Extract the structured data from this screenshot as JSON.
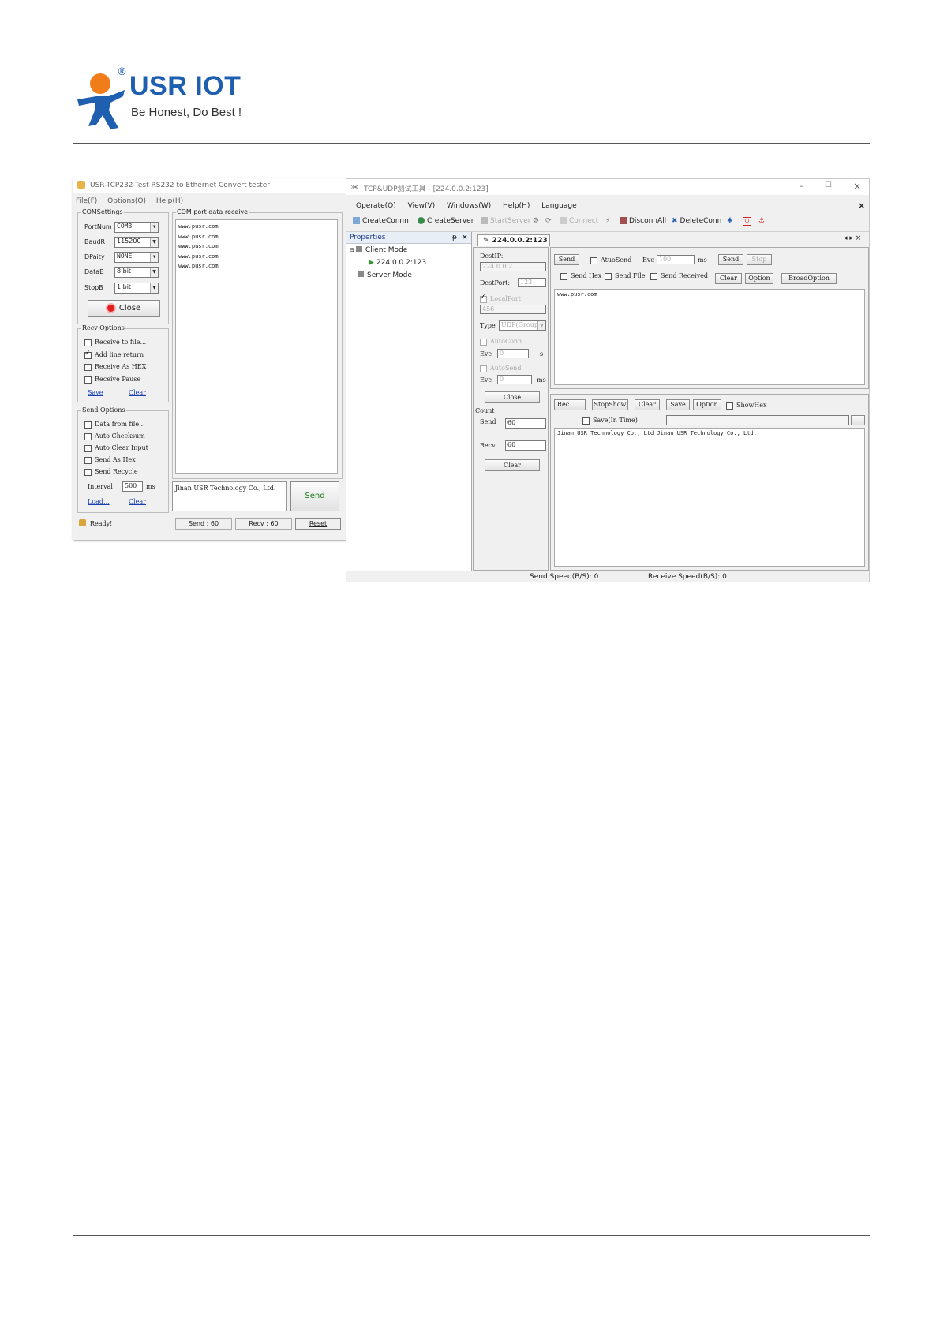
{
  "header": {
    "brand": "USR IOT",
    "registered_mark": "®",
    "slogan": "Be Honest, Do Best !"
  },
  "left_app": {
    "title": "USR-TCP232-Test  RS232 to Ethernet Convert tester",
    "menu": [
      "File(F)",
      "Options(O)",
      "Help(H)"
    ],
    "com_settings": {
      "legend": "COMSettings",
      "fields": [
        {
          "label": "PortNum",
          "value": "COM3"
        },
        {
          "label": "BaudR",
          "value": "115200"
        },
        {
          "label": "DPaity",
          "value": "NONE"
        },
        {
          "label": "DataB",
          "value": "8 bit"
        },
        {
          "label": "StopB",
          "value": "1 bit"
        }
      ],
      "close_label": "Close"
    },
    "recv_options": {
      "legend": "Recv Options",
      "items": [
        {
          "label": "Receive to file...",
          "checked": false
        },
        {
          "label": "Add line return",
          "checked": true
        },
        {
          "label": "Receive As HEX",
          "checked": false
        },
        {
          "label": "Receive Pause",
          "checked": false
        }
      ],
      "save": "Save",
      "clear": "Clear"
    },
    "send_options": {
      "legend": "Send Options",
      "items": [
        {
          "label": "Data from file...",
          "checked": false
        },
        {
          "label": "Auto Checksum",
          "checked": false
        },
        {
          "label": "Auto Clear Input",
          "checked": false
        },
        {
          "label": "Send As Hex",
          "checked": false
        },
        {
          "label": "Send Recycle",
          "checked": false
        }
      ],
      "interval_label": "Interval",
      "interval_value": "500",
      "interval_unit": "ms",
      "load": "Load...",
      "clear": "Clear"
    },
    "receive_panel": {
      "legend": "COM port data receive",
      "lines": [
        "www.pusr.com",
        "www.pusr.com",
        "www.pusr.com",
        "www.pusr.com",
        "www.pusr.com"
      ]
    },
    "send_text": "Jinan USR Technology Co., Ltd.",
    "send_button": "Send",
    "status": {
      "ready": "Ready!",
      "send": "Send : 60",
      "recv": "Recv : 60",
      "reset": "Reset"
    }
  },
  "right_app": {
    "title": "TCP&UDP测试工具 - [224.0.0.2:123]",
    "menu": [
      "Operate(O)",
      "View(V)",
      "Windows(W)",
      "Help(H)",
      "Language"
    ],
    "toolbar": {
      "create_conn": "CreateConnn",
      "create_server": "CreateServer",
      "start_server": "StartServer",
      "connect": "Connect",
      "disconn_all": "DisconnAll",
      "delete_conn": "DeleteConn"
    },
    "properties": {
      "title": "Properties",
      "pin": "ᵽ",
      "close": "×",
      "tree": {
        "client_mode": "Client Mode",
        "client_child": "224.0.0.2:123",
        "server_mode": "Server Mode"
      }
    },
    "tab": "224.0.0.2:123",
    "conn_panel": {
      "dest_ip_label": "DestIP:",
      "dest_ip": "224.0.0.2",
      "dest_port_label": "DestPort:",
      "dest_port": "123",
      "local_port_label": "LocalPort",
      "local_port": "456",
      "type_label": "Type",
      "type_value": "UDP(Group)",
      "auto_conn": "AutoConn",
      "eve_label": "Eve",
      "eve1": "0",
      "eve1_unit": "s",
      "auto_send": "AutoSend",
      "eve2": "0",
      "eve2_unit": "ms",
      "close": "Close",
      "count_label": "Count",
      "send_label": "Send",
      "send_count": "60",
      "recv_label": "Recv",
      "recv_count": "60",
      "clear": "Clear"
    },
    "send_area": {
      "send": "Send",
      "atuo_send": "AtuoSend",
      "eve_label": "Eve",
      "eve_value": "100",
      "eve_unit": "ms",
      "send2": "Send",
      "stop": "Stop",
      "send_hex": "Send Hex",
      "send_file": "Send File",
      "send_received": "Send Received",
      "clear": "Clear",
      "option": "Option",
      "broad_option": "BroadOption",
      "content": "www.pusr.com"
    },
    "recv_area": {
      "rec": "Rec",
      "stop_show": "StopShow",
      "clear": "Clear",
      "save": "Save",
      "option": "Option",
      "show_hex": "ShowHex",
      "save_in_time": "Save(In Time)",
      "browse": "...",
      "content": "Jinan USR Technology Co., Ltd Jinan USR Technology Co., Ltd."
    },
    "status": {
      "send_speed": "Send Speed(B/S): 0",
      "recv_speed": "Receive Speed(B/S): 0"
    }
  }
}
